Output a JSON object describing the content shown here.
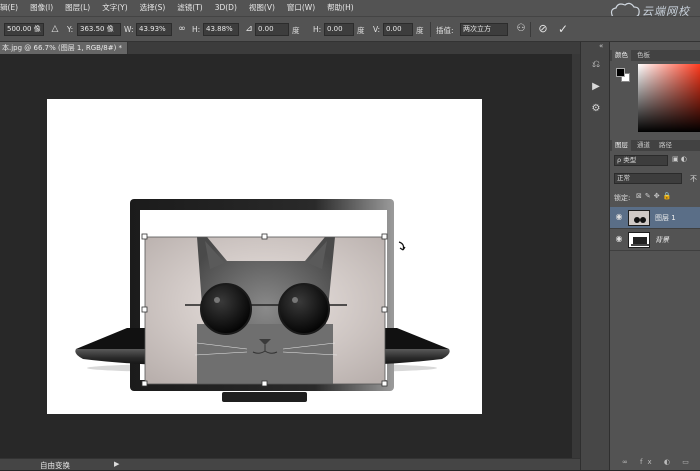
{
  "menu": {
    "items": [
      "辑(E)",
      "图像(I)",
      "图层(L)",
      "文字(Y)",
      "选择(S)",
      "滤镜(T)",
      "3D(D)",
      "视图(V)",
      "窗口(W)",
      "帮助(H)"
    ]
  },
  "options": {
    "x_value": "500.00 像",
    "y_label": "Y:",
    "y_value": "363.50 像",
    "w_label": "W:",
    "w_value": "43.93%",
    "h_label": "H:",
    "h_value": "43.88%",
    "angle_value": "0.00",
    "angle_unit": "度",
    "hskew_label": "H:",
    "hskew_value": "0.00",
    "hskew_unit": "度",
    "vskew_label": "V:",
    "vskew_value": "0.00",
    "vskew_unit": "度",
    "interp_label": "插值:",
    "interp_value": "两次立方"
  },
  "document": {
    "tab_title": "本.jpg @ 66.7% (图层 1, RGB/8#) *"
  },
  "status": {
    "tool_name": "自由变换"
  },
  "panels": {
    "color_tabs": [
      "颜色",
      "色板"
    ],
    "layers_tabs": [
      "图层",
      "通道",
      "路径"
    ],
    "filter_kind": "ρ 类型",
    "blend_mode": "正常",
    "opacity_label": "不",
    "lock_label": "锁定:",
    "layers": [
      {
        "name": "图层 1",
        "selected": true
      },
      {
        "name": "背景",
        "selected": false
      }
    ]
  },
  "watermark": {
    "text": "云端网校"
  },
  "colors": {
    "ui_dark": "#535353",
    "canvas_bg": "#282828",
    "selection": "#5a6e87"
  }
}
